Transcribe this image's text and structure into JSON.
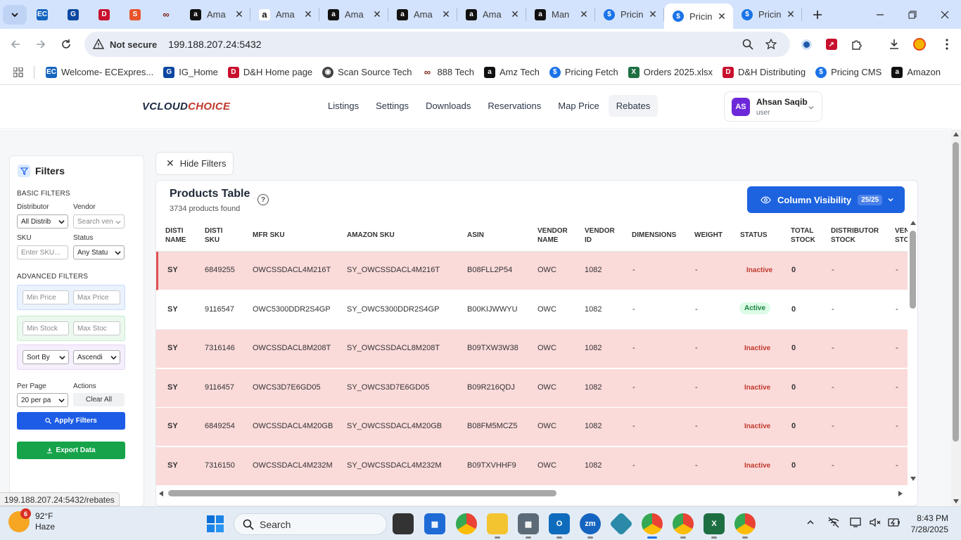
{
  "browser": {
    "tabs": [
      {
        "title": "Ama",
        "favicon": "amazon",
        "active": false
      },
      {
        "title": "Ama",
        "favicon": "amazon-smile",
        "active": false
      },
      {
        "title": "Ama",
        "favicon": "amazon",
        "active": false
      },
      {
        "title": "Ama",
        "favicon": "amazon",
        "active": false
      },
      {
        "title": "Ama",
        "favicon": "amazon",
        "active": false
      },
      {
        "title": "Man",
        "favicon": "amazon",
        "active": false
      },
      {
        "title": "Pricin",
        "favicon": "pricing",
        "active": false
      },
      {
        "title": "Pricin",
        "favicon": "pricing",
        "active": true
      },
      {
        "title": "Pricin",
        "favicon": "pricing",
        "active": false
      }
    ],
    "address": {
      "security_label": "Not secure",
      "url": "199.188.207.24:5432"
    },
    "bookmarks": [
      {
        "label": "Welcome- ECExpres...",
        "icon": "ec-icon"
      },
      {
        "label": "IG_Home",
        "icon": "ig-icon"
      },
      {
        "label": "D&H Home page",
        "icon": "dh-icon"
      },
      {
        "label": "Scan Source Tech",
        "icon": "globe-icon"
      },
      {
        "label": "888 Tech",
        "icon": "888-icon"
      },
      {
        "label": "Amz Tech",
        "icon": "amazon-icon"
      },
      {
        "label": "Pricing Fetch",
        "icon": "pricing-icon"
      },
      {
        "label": "Orders 2025.xlsx",
        "icon": "excel-icon"
      },
      {
        "label": "D&H Distributing",
        "icon": "dh-icon"
      },
      {
        "label": "Pricing CMS",
        "icon": "pricing-icon"
      },
      {
        "label": "Amazon",
        "icon": "amazon-icon"
      }
    ],
    "status_url": "199.188.207.24:5432/rebates"
  },
  "app": {
    "logo_main": "VCLOUD",
    "logo_accent": "CHOICE",
    "nav": [
      {
        "label": "Listings",
        "active": false
      },
      {
        "label": "Settings",
        "active": false
      },
      {
        "label": "Downloads",
        "active": false
      },
      {
        "label": "Reservations",
        "active": false
      },
      {
        "label": "Map Price",
        "active": false
      },
      {
        "label": "Rebates",
        "active": true
      }
    ],
    "user": {
      "initials": "AS",
      "name": "Ahsan Saqib",
      "role": "user"
    }
  },
  "filters": {
    "title": "Filters",
    "basic_label": "BASIC FILTERS",
    "distributor_label": "Distributor",
    "distributor_value": "All Distrib",
    "vendor_label": "Vendor",
    "vendor_placeholder": "Search ven",
    "sku_label": "SKU",
    "sku_placeholder": "Enter SKU...",
    "status_label": "Status",
    "status_value": "Any Statu",
    "advanced_label": "ADVANCED FILTERS",
    "min_price_placeholder": "Min Price",
    "max_price_placeholder": "Max Price",
    "min_stock_placeholder": "Min Stock",
    "max_stock_placeholder": "Max Stoc",
    "sort_by_value": "Sort By",
    "sort_order_value": "Ascendi",
    "per_page_label": "Per Page",
    "per_page_value": "20 per pa",
    "actions_label": "Actions",
    "clear_all": "Clear All",
    "apply": "Apply Filters",
    "export": "Export Data"
  },
  "hide_filters_label": "Hide Filters",
  "table": {
    "title": "Products Table",
    "count_text": "3734 products found",
    "help_glyph": "?",
    "column_visibility_label": "Column Visibility",
    "column_visibility_badge": "25/25",
    "columns": [
      "DISTI NAME",
      "DISTI SKU",
      "MFR SKU",
      "AMAZON SKU",
      "ASIN",
      "VENDOR NAME",
      "VENDOR ID",
      "DIMENSIONS",
      "WEIGHT",
      "STATUS",
      "TOTAL STOCK",
      "DISTRIBUTOR STOCK",
      "VEN STO"
    ],
    "rows": [
      {
        "disti_name": "SY",
        "disti_sku": "6849255",
        "mfr_sku": "OWCSSDACL4M216T",
        "amazon_sku": "SY_OWCSSDACL4M216T",
        "asin": "B08FLL2P54",
        "vendor_name": "OWC",
        "vendor_id": "1082",
        "dimensions": "-",
        "weight": "-",
        "status": "Inactive",
        "total_stock": "0",
        "distributor_stock": "-",
        "vendor_stock": "-"
      },
      {
        "disti_name": "SY",
        "disti_sku": "9116547",
        "mfr_sku": "OWC5300DDR2S4GP",
        "amazon_sku": "SY_OWC5300DDR2S4GP",
        "asin": "B00KIJWWYU",
        "vendor_name": "OWC",
        "vendor_id": "1082",
        "dimensions": "-",
        "weight": "-",
        "status": "Active",
        "total_stock": "0",
        "distributor_stock": "-",
        "vendor_stock": "-"
      },
      {
        "disti_name": "SY",
        "disti_sku": "7316146",
        "mfr_sku": "OWCSSDACL8M208T",
        "amazon_sku": "SY_OWCSSDACL8M208T",
        "asin": "B09TXW3W38",
        "vendor_name": "OWC",
        "vendor_id": "1082",
        "dimensions": "-",
        "weight": "-",
        "status": "Inactive",
        "total_stock": "0",
        "distributor_stock": "-",
        "vendor_stock": "-"
      },
      {
        "disti_name": "SY",
        "disti_sku": "9116457",
        "mfr_sku": "OWCS3D7E6GD05",
        "amazon_sku": "SY_OWCS3D7E6GD05",
        "asin": "B09R216QDJ",
        "vendor_name": "OWC",
        "vendor_id": "1082",
        "dimensions": "-",
        "weight": "-",
        "status": "Inactive",
        "total_stock": "0",
        "distributor_stock": "-",
        "vendor_stock": "-"
      },
      {
        "disti_name": "SY",
        "disti_sku": "6849254",
        "mfr_sku": "OWCSSDACL4M20GB",
        "amazon_sku": "SY_OWCSSDACL4M20GB",
        "asin": "B08FM5MCZ5",
        "vendor_name": "OWC",
        "vendor_id": "1082",
        "dimensions": "-",
        "weight": "-",
        "status": "Inactive",
        "total_stock": "0",
        "distributor_stock": "-",
        "vendor_stock": "-"
      },
      {
        "disti_name": "SY",
        "disti_sku": "7316150",
        "mfr_sku": "OWCSSDACL4M232M",
        "amazon_sku": "SY_OWCSSDACL4M232M",
        "asin": "B09TXVHHF9",
        "vendor_name": "OWC",
        "vendor_id": "1082",
        "dimensions": "-",
        "weight": "-",
        "status": "Inactive",
        "total_stock": "0",
        "distributor_stock": "-",
        "vendor_stock": "-"
      }
    ]
  },
  "taskbar": {
    "weather_temp": "92°F",
    "weather_desc": "Haze",
    "weather_badge": "6",
    "search_label": "Search",
    "time": "8:43 PM",
    "date": "7/28/2025"
  },
  "colors": {
    "accent_blue": "#1d63e0",
    "inactive_row": "#fbdada",
    "export_green": "#16a34a",
    "avatar_purple": "#6d28d9"
  }
}
